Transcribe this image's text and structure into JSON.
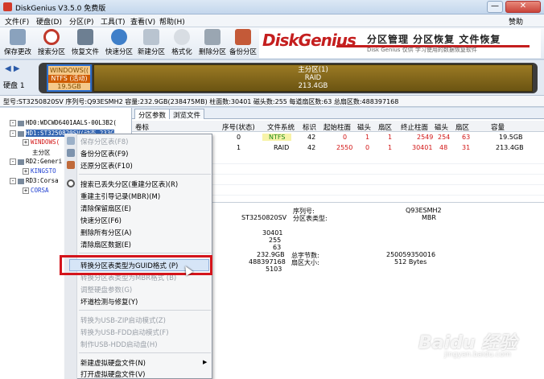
{
  "window": {
    "title": "DiskGenius V3.5.0 免费版",
    "minimize_label": "—",
    "close_label": "✕"
  },
  "menubar": {
    "items": [
      "文件(F)",
      "硬盘(D)",
      "分区(P)",
      "工具(T)",
      "查看(V)",
      "帮助(H)"
    ],
    "help_link": "赞助"
  },
  "toolbar": {
    "buttons": [
      "保存更改",
      "搜索分区",
      "恢复文件",
      "快速分区",
      "新建分区",
      "格式化",
      "删除分区",
      "备份分区"
    ]
  },
  "banner": {
    "logo": "DiskGenius",
    "slogan": "分区管理 分区恢复 文件恢复",
    "sub": "Disk Genius 仅供 学习使用的数据恢复软件"
  },
  "diskmap": {
    "nav": "◀ ▶",
    "disk_label": "硬盘 1",
    "win_name": "WINDOWS((",
    "win_fs": "NTFS (活动)",
    "win_size": "19.5GB",
    "main_name": "主分区(1)",
    "main_fs": "RAID",
    "main_size": "213.4GB"
  },
  "diskinfo": "型号:ST3250820SV  序列号:Q93ESMH2  容量:232.9GB(238475MB)  柱面数:30401  磁头数:255  每道扇区数:63  总扇区数:488397168",
  "tree": {
    "rows": [
      "HD0:WDCWD6401AALS-00L3B2(",
      "HD1:ST3250820SV(动态 233G",
      "WINDOWS(",
      "主分区",
      "RD2:Generi",
      "KINGSTO",
      "RD3:Corsa",
      "CORSA"
    ]
  },
  "tabs": [
    "分区参数",
    "浏览文件"
  ],
  "grid": {
    "headers": [
      "卷标",
      "序号(状态)",
      "文件系统",
      "标识",
      "起始柱面",
      "磁头",
      "扇区",
      "终止柱面",
      "磁头",
      "扇区",
      "容量"
    ],
    "rows": [
      [
        "0",
        "NTFS",
        "42",
        "0",
        "1",
        "1",
        "2549",
        "254",
        "63",
        "19.5GB"
      ],
      [
        "1",
        "RAID",
        "42",
        "2550",
        "0",
        "1",
        "30401",
        "48",
        "31",
        "213.4GB"
      ]
    ]
  },
  "details": {
    "model": "ST3250820SV",
    "serial_label": "序列号:",
    "serial": "Q93ESMH2",
    "pt_type_label": "分区表类型:",
    "pt_type": "MBR",
    "cylinders": "30401",
    "heads": "255",
    "sectors": "63",
    "capacity": "232.9GB",
    "total_bytes_label": "总字节数:",
    "total_bytes": "250059350016",
    "total_sectors": "488397168",
    "sector_size_label": "扇区大小:",
    "sector_size": "512 Bytes",
    "extra": "5103"
  },
  "context_menu": {
    "items": [
      {
        "label": "保存分区表(F8)",
        "disabled": true
      },
      {
        "label": "备份分区表(F9)",
        "disabled": false
      },
      {
        "label": "还原分区表(F10)",
        "disabled": false
      },
      {
        "label": "搜索已丢失分区(重建分区表)(R)",
        "disabled": false
      },
      {
        "label": "重建主引导记录(MBR)(M)",
        "disabled": false
      },
      {
        "label": "清除保留扇区(E)",
        "disabled": false
      },
      {
        "label": "快速分区(F6)",
        "disabled": false
      },
      {
        "label": "删除所有分区(A)",
        "disabled": false
      },
      {
        "label": "清除扇区数据(E)",
        "disabled": false
      },
      {
        "label": "转换分区表类型为GUID格式 (P)",
        "disabled": false
      },
      {
        "label": "转换分区表类型为MBR格式 (B)",
        "disabled": true
      },
      {
        "label": "调整硬盘参数(G)",
        "disabled": true
      },
      {
        "label": "坏道检测与修复(Y)",
        "disabled": false
      },
      {
        "label": "转换为USB-ZIP启动模式(Z)",
        "disabled": true
      },
      {
        "label": "转换为USB-FDD启动模式(F)",
        "disabled": true
      },
      {
        "label": "制作USB-HDD启动盘(H)",
        "disabled": true
      },
      {
        "label": "新建虚拟硬盘文件(N)",
        "disabled": false
      },
      {
        "label": "打开虚拟硬盘文件(V)",
        "disabled": false
      }
    ],
    "submenu_arrow": "▶"
  },
  "watermark": {
    "logo": "Baidu 经验",
    "sub": "jingyan.baidu.com"
  },
  "colors": {
    "highlight_box": "#d4141b",
    "selection": "#3163b0",
    "partition_ntfs": "#f5c98a",
    "partition_raid": "#8a6a1c"
  }
}
